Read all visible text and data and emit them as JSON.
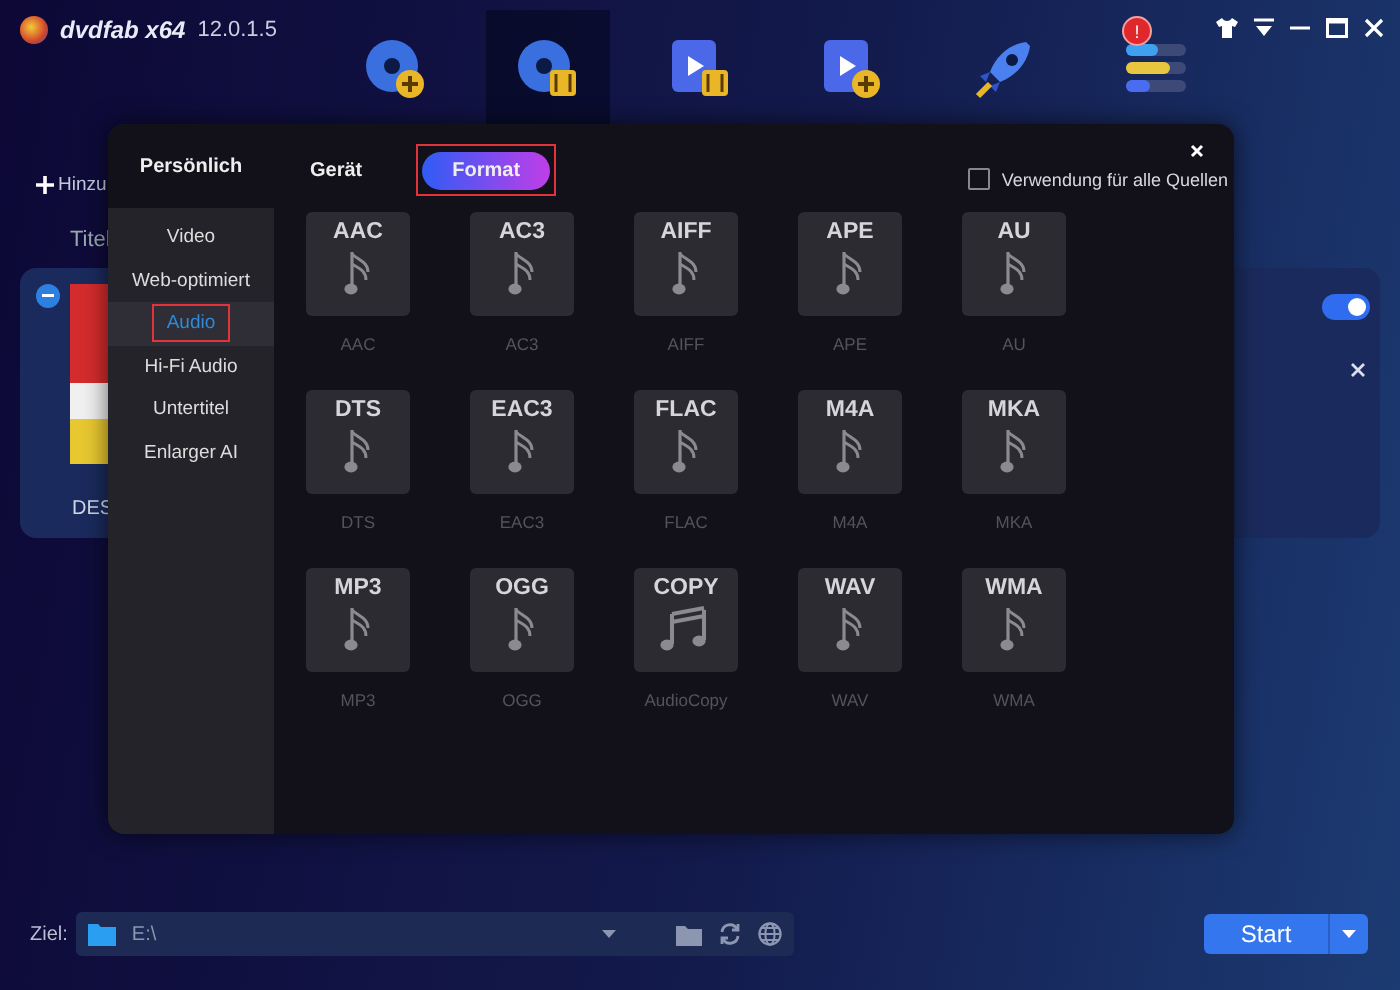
{
  "app": {
    "logo": "dvdfab x64",
    "version": "12.0.1.5",
    "alert_badge": "!"
  },
  "nav": [
    {
      "kind": "disc-plus",
      "selected": false
    },
    {
      "kind": "disc-film",
      "selected": true
    },
    {
      "kind": "film",
      "selected": false
    },
    {
      "kind": "film-plus",
      "selected": false
    },
    {
      "kind": "rocket",
      "selected": false
    },
    {
      "kind": "toolbox",
      "selected": false
    }
  ],
  "background": {
    "add_button": "Hinzu",
    "title_column": "Titel",
    "item": {
      "title": "DES",
      "enabled": true
    }
  },
  "dialog": {
    "sidebar_heading": "Persönlich",
    "sidebar": [
      {
        "label": "Video",
        "selected": false,
        "highlighted": false
      },
      {
        "label": "Web-optimiert",
        "selected": false,
        "highlighted": false
      },
      {
        "label": "Audio",
        "selected": true,
        "highlighted": true
      },
      {
        "label": "Hi-Fi Audio",
        "selected": false,
        "highlighted": false
      },
      {
        "label": "Untertitel",
        "selected": false,
        "highlighted": false
      },
      {
        "label": "Enlarger AI",
        "selected": false,
        "highlighted": false
      }
    ],
    "tabs": [
      {
        "label": "Gerät",
        "selected": false,
        "highlighted": false
      },
      {
        "label": "Format",
        "selected": true,
        "highlighted": true
      }
    ],
    "apply_all": {
      "label": "Verwendung für alle Quellen",
      "checked": false
    },
    "formats": [
      {
        "badge": "AAC",
        "label": "AAC",
        "kind": "note"
      },
      {
        "badge": "AC3",
        "label": "AC3",
        "kind": "note"
      },
      {
        "badge": "AIFF",
        "label": "AIFF",
        "kind": "note"
      },
      {
        "badge": "APE",
        "label": "APE",
        "kind": "note"
      },
      {
        "badge": "AU",
        "label": "AU",
        "kind": "note"
      },
      {
        "badge": "DTS",
        "label": "DTS",
        "kind": "note"
      },
      {
        "badge": "EAC3",
        "label": "EAC3",
        "kind": "note"
      },
      {
        "badge": "FLAC",
        "label": "FLAC",
        "kind": "note"
      },
      {
        "badge": "M4A",
        "label": "M4A",
        "kind": "note"
      },
      {
        "badge": "MKA",
        "label": "MKA",
        "kind": "note"
      },
      {
        "badge": "MP3",
        "label": "MP3",
        "kind": "note"
      },
      {
        "badge": "OGG",
        "label": "OGG",
        "kind": "note"
      },
      {
        "badge": "COPY",
        "label": "AudioCopy",
        "kind": "double-note"
      },
      {
        "badge": "WAV",
        "label": "WAV",
        "kind": "note"
      },
      {
        "badge": "WMA",
        "label": "WMA",
        "kind": "note"
      }
    ]
  },
  "bottom": {
    "target_label": "Ziel:",
    "path": "E:\\",
    "start_button": "Start"
  }
}
